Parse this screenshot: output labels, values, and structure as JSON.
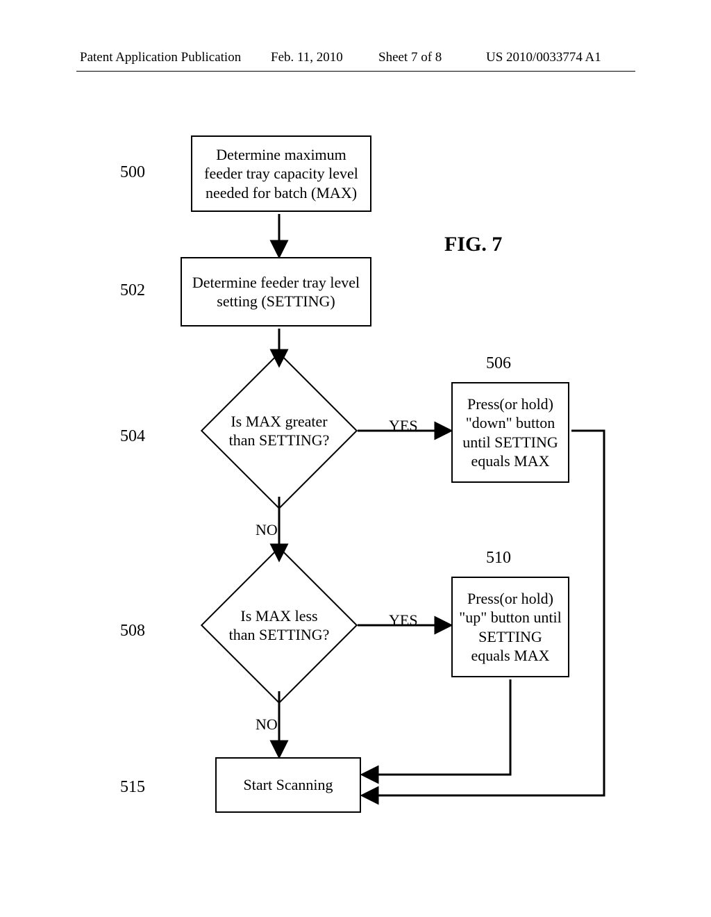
{
  "header": {
    "left": "Patent Application Publication",
    "date": "Feb. 11, 2010",
    "sheet": "Sheet 7 of 8",
    "pubno": "US 2010/0033774 A1"
  },
  "figure_label": "FIG. 7",
  "refs": {
    "r500": "500",
    "r502": "502",
    "r504": "504",
    "r506": "506",
    "r508": "508",
    "r510": "510",
    "r515": "515"
  },
  "nodes": {
    "n500": "Determine maximum feeder tray capacity level needed for batch (MAX)",
    "n502": "Determine feeder tray level setting (SETTING)",
    "n504": "Is MAX greater than SETTING?",
    "n506": "Press(or hold) \"down\" button until SETTING equals MAX",
    "n508": "Is MAX less than SETTING?",
    "n510": "Press(or hold) \"up\" button until SETTING equals MAX",
    "n515": "Start Scanning"
  },
  "edge_labels": {
    "yes": "YES",
    "no": "NO"
  }
}
